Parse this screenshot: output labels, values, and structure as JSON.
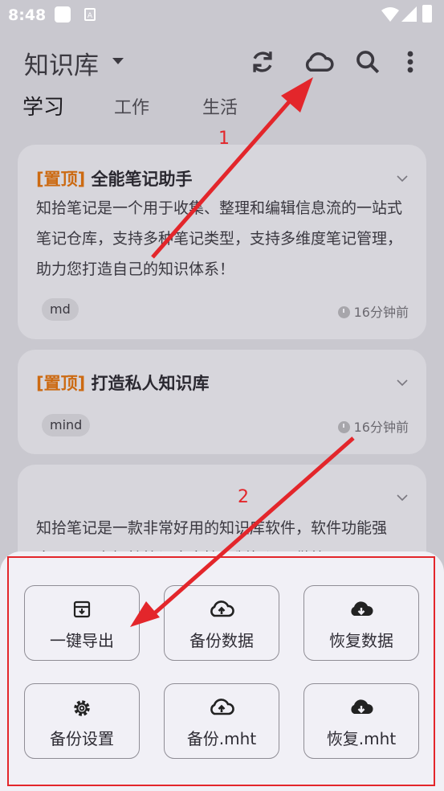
{
  "status_bar": {
    "time": "8:48",
    "sim_label": "A"
  },
  "app_bar": {
    "title": "知识库",
    "icons": [
      "sync-icon",
      "cloud-icon",
      "search-icon",
      "more-vert-icon"
    ]
  },
  "tabs": [
    {
      "label": "学习",
      "active": true
    },
    {
      "label": "工作",
      "active": false
    },
    {
      "label": "生活",
      "active": false
    }
  ],
  "notes": [
    {
      "pin": "[置顶]",
      "title": "全能笔记助手",
      "body": "知拾笔记是一个用于收集、整理和编辑信息流的一站式笔记仓库，支持多种笔记类型，支持多维度笔记管理，助力您打造自己的知识体系！",
      "tag": "md",
      "time": "16分钟前"
    },
    {
      "pin": "[置顶]",
      "title": "打造私人知识库",
      "tag": "mind",
      "time": "16分钟前"
    },
    {
      "body": "知拾笔记是一款非常好用的知识库软件，软件功能强大，可以在知拾笔记中直接复制标记，做笔"
    }
  ],
  "sheet": {
    "buttons": [
      {
        "label": "一键导出",
        "icon": "archive-icon"
      },
      {
        "label": "备份数据",
        "icon": "cloud-upload-icon"
      },
      {
        "label": "恢复数据",
        "icon": "cloud-download-icon"
      },
      {
        "label": "备份设置",
        "icon": "gear-icon"
      },
      {
        "label": "备份.mht",
        "icon": "cloud-upload-icon"
      },
      {
        "label": "恢复.mht",
        "icon": "cloud-download-icon"
      }
    ]
  },
  "annotations": {
    "step1": "1",
    "step2": "2",
    "color": "#e3262b"
  },
  "colors": {
    "pin": "#cc6a12",
    "background": "#c9c8cf",
    "sheet": "#f1f0f6"
  }
}
